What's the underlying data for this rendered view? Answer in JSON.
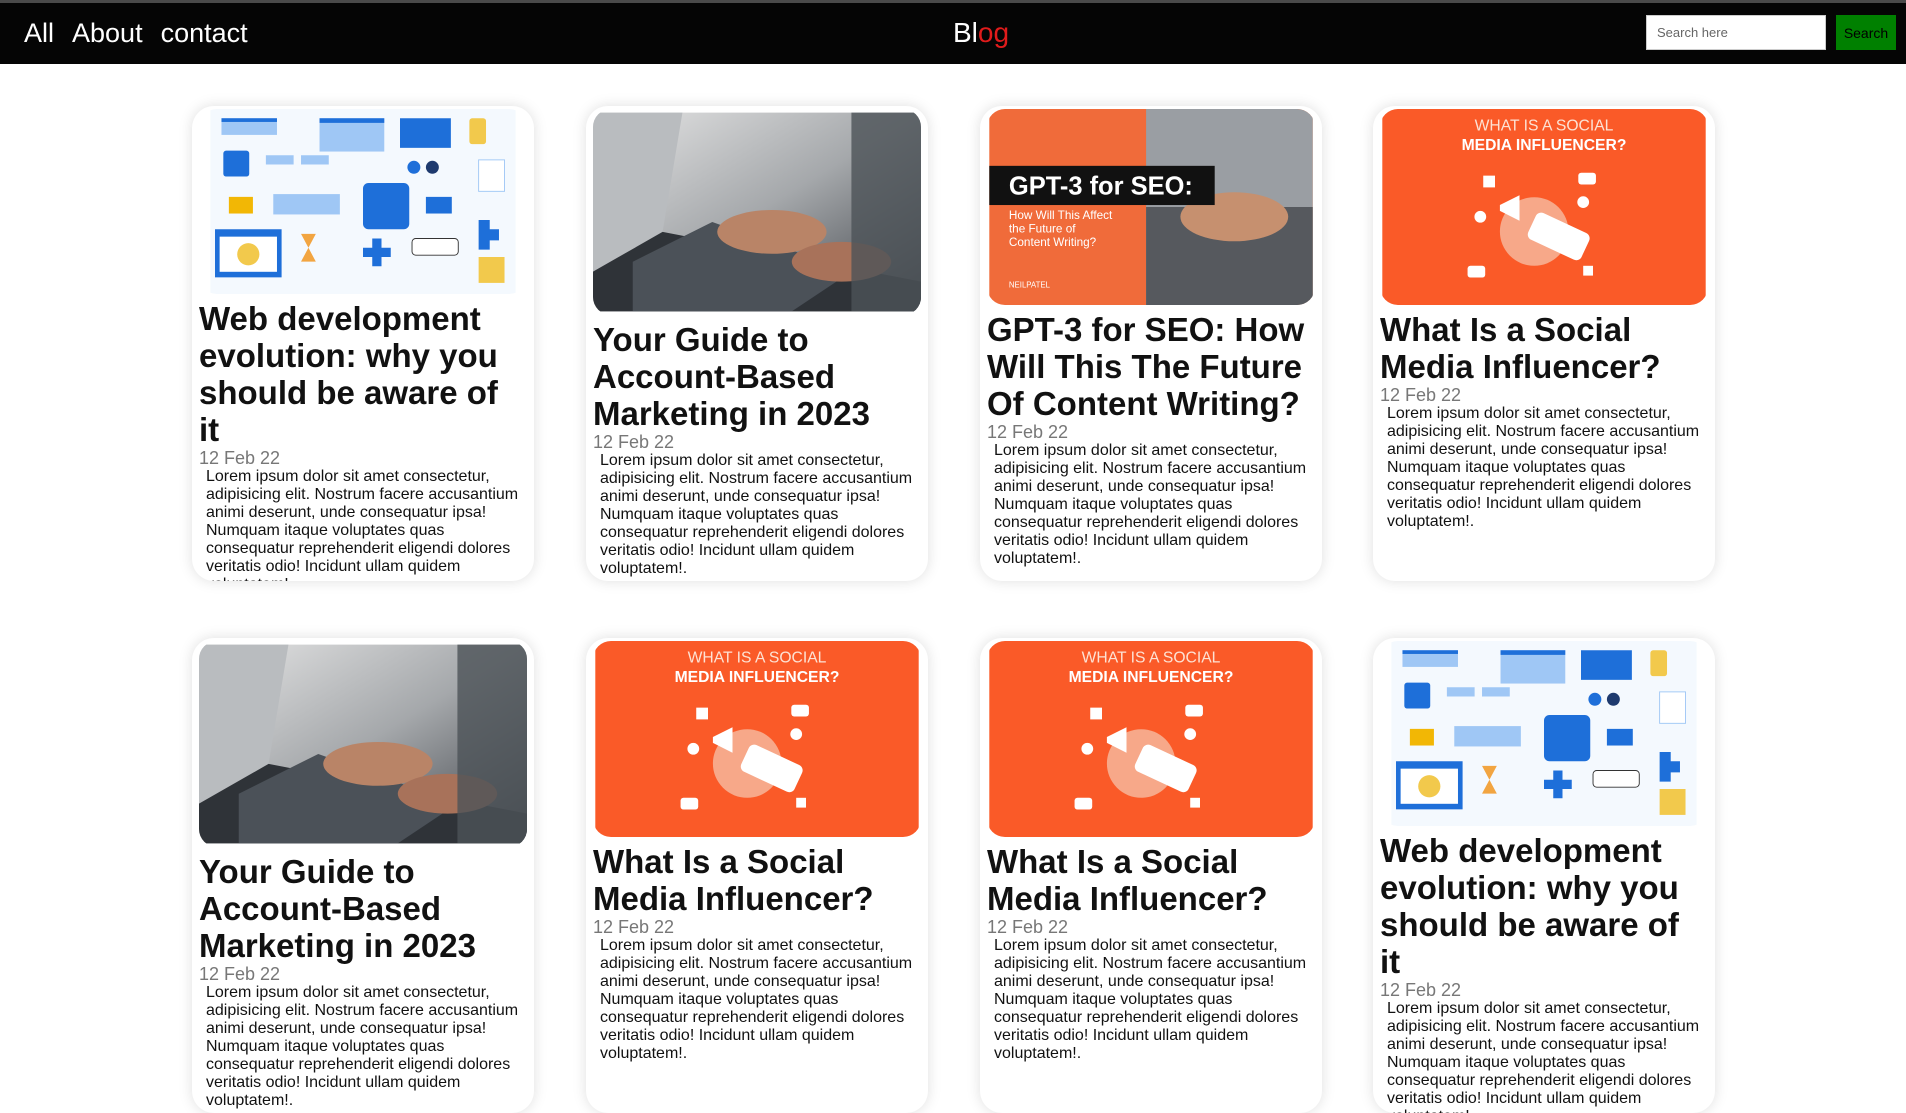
{
  "nav": {
    "links": [
      "All",
      "About",
      "contact"
    ],
    "brand_left": "Bl",
    "brand_right": "og",
    "search_placeholder": "Search here",
    "search_button": "Search"
  },
  "colors": {
    "nav_bg": "#050505",
    "brand_accent": "#e01b1b",
    "search_btn": "#008000",
    "social_orange": "#fa5a28"
  },
  "cards": [
    {
      "image": "web-illustration",
      "title": "Web development evolution: why you should be aware of it",
      "date": "12 Feb 22",
      "body": "Lorem ipsum dolor sit amet consectetur, adipisicing elit. Nostrum facere accusantium animi deserunt, unde consequatur ipsa! Numquam itaque voluptates quas consequatur reprehenderit eligendi dolores veritatis odio! Incidunt ullam quidem voluptatem!."
    },
    {
      "image": "laptop-photo",
      "title": "Your Guide to Account-Based Marketing in 2023",
      "date": "12 Feb 22",
      "body": "Lorem ipsum dolor sit amet consectetur, adipisicing elit. Nostrum facere accusantium animi deserunt, unde consequatur ipsa! Numquam itaque voluptates quas consequatur reprehenderit eligendi dolores veritatis odio! Incidunt ullam quidem voluptatem!."
    },
    {
      "image": "gpt-banner",
      "image_text": {
        "headline": "GPT-3 for SEO:",
        "sub": "How Will This Affect the Future of Content Writing?",
        "brand": "NEILPATEL"
      },
      "title": "GPT-3 for SEO: How Will This The Future Of Content Writing?",
      "date": "12 Feb 22",
      "body": "Lorem ipsum dolor sit amet consectetur, adipisicing elit. Nostrum facere accusantium animi deserunt, unde consequatur ipsa! Numquam itaque voluptates quas consequatur reprehenderit eligendi dolores veritatis odio! Incidunt ullam quidem voluptatem!."
    },
    {
      "image": "social-banner",
      "image_text": {
        "line1": "WHAT IS A SOCIAL",
        "line2": "MEDIA INFLUENCER?"
      },
      "title": "What Is a Social Media Influencer?",
      "date": "12 Feb 22",
      "body": "Lorem ipsum dolor sit amet consectetur, adipisicing elit. Nostrum facere accusantium animi deserunt, unde consequatur ipsa! Numquam itaque voluptates quas consequatur reprehenderit eligendi dolores veritatis odio! Incidunt ullam quidem voluptatem!."
    },
    {
      "image": "laptop-photo",
      "title": "Your Guide to Account-Based Marketing in 2023",
      "date": "12 Feb 22",
      "body": "Lorem ipsum dolor sit amet consectetur, adipisicing elit. Nostrum facere accusantium animi deserunt, unde consequatur ipsa! Numquam itaque voluptates quas consequatur reprehenderit eligendi dolores veritatis odio! Incidunt ullam quidem voluptatem!."
    },
    {
      "image": "social-banner",
      "image_text": {
        "line1": "WHAT IS A SOCIAL",
        "line2": "MEDIA INFLUENCER?"
      },
      "title": "What Is a Social Media Influencer?",
      "date": "12 Feb 22",
      "body": "Lorem ipsum dolor sit amet consectetur, adipisicing elit. Nostrum facere accusantium animi deserunt, unde consequatur ipsa! Numquam itaque voluptates quas consequatur reprehenderit eligendi dolores veritatis odio! Incidunt ullam quidem voluptatem!."
    },
    {
      "image": "social-banner",
      "image_text": {
        "line1": "WHAT IS A SOCIAL",
        "line2": "MEDIA INFLUENCER?"
      },
      "title": "What Is a Social Media Influencer?",
      "date": "12 Feb 22",
      "body": "Lorem ipsum dolor sit amet consectetur, adipisicing elit. Nostrum facere accusantium animi deserunt, unde consequatur ipsa! Numquam itaque voluptates quas consequatur reprehenderit eligendi dolores veritatis odio! Incidunt ullam quidem voluptatem!."
    },
    {
      "image": "web-illustration",
      "title": "Web development evolution: why you should be aware of it",
      "date": "12 Feb 22",
      "body": "Lorem ipsum dolor sit amet consectetur, adipisicing elit. Nostrum facere accusantium animi deserunt, unde consequatur ipsa! Numquam itaque voluptates quas consequatur reprehenderit eligendi dolores veritatis odio! Incidunt ullam quidem voluptatem!."
    }
  ]
}
